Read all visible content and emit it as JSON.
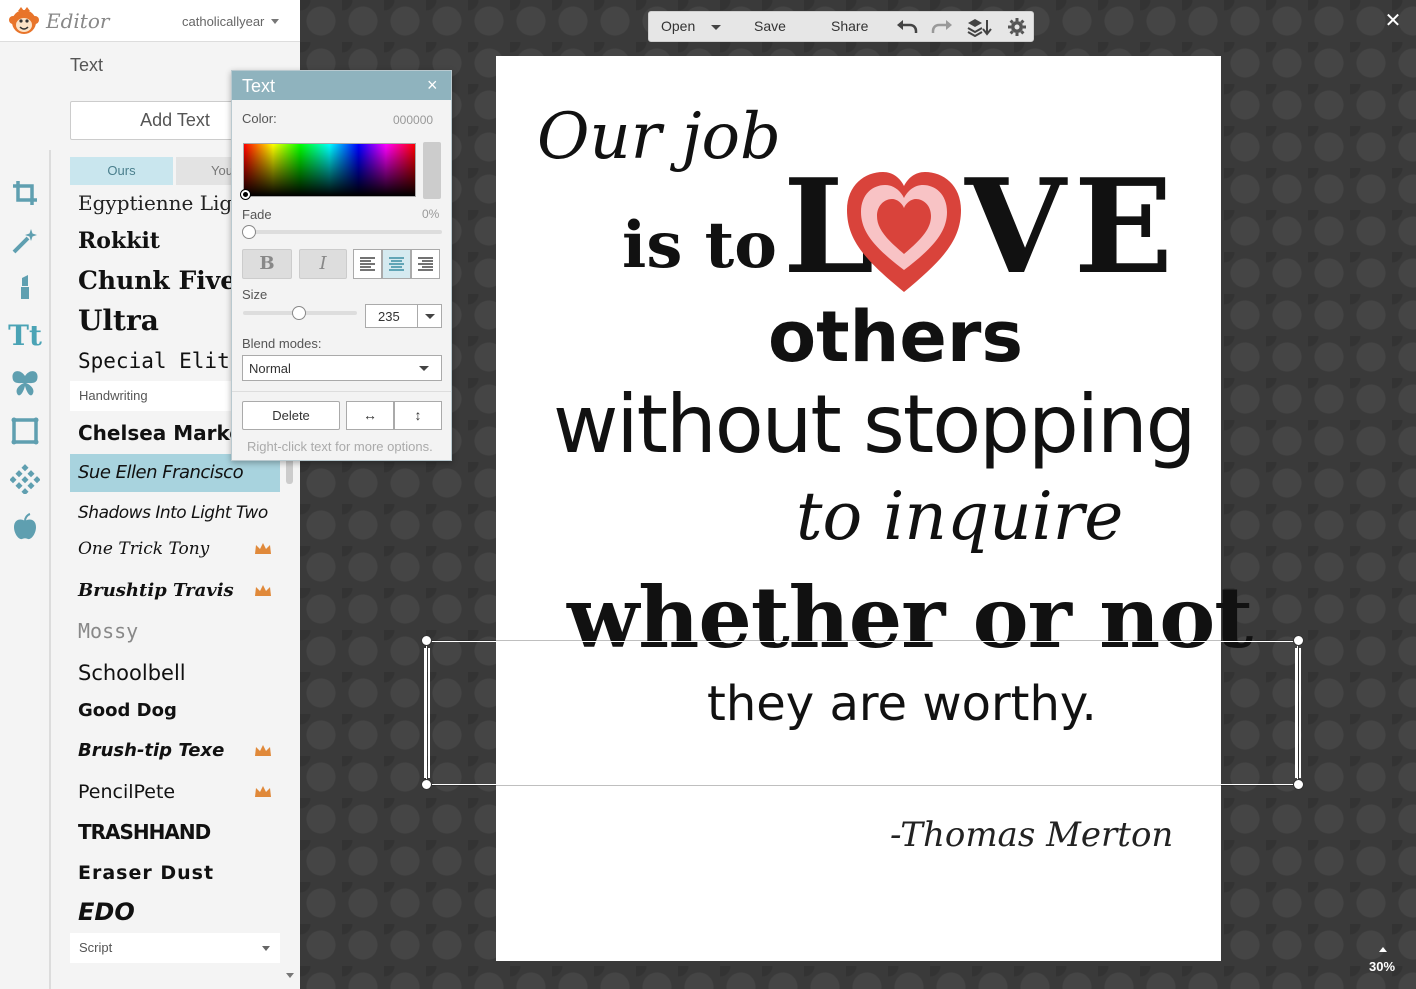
{
  "app": {
    "title": "Editor",
    "account": "catholicallyear"
  },
  "panel": {
    "title": "Text",
    "add_text": "Add Text",
    "tabs": [
      "Ours",
      "You"
    ]
  },
  "fonts": {
    "egyptienne": "Egyptienne Light",
    "rokkit": "Rokkit",
    "chunk_five": "Chunk Five",
    "ultra": "Ultra",
    "special_elite": "Special Elite",
    "handwriting_header": "Handwriting",
    "chelsea": "Chelsea Market",
    "sue_ellen": "Sue Ellen Francisco",
    "shadows": "Shadows Into Light Two",
    "one_trick": "One Trick Tony",
    "brushtip_travis": "Brushtip Travis",
    "mossy": "Mossy",
    "schoolbell": "Schoolbell",
    "good_dog": "Good Dog",
    "brush_tip_texe": "Brush-tip Texe",
    "pencilpete": "PencilPete",
    "trashhand": "TRASHHAND",
    "eraser_dust": "Eraser Dust",
    "edo": "EDO",
    "script_header": "Script"
  },
  "toolbar": {
    "open": "Open",
    "save": "Save",
    "share": "Share"
  },
  "dialog": {
    "title": "Text",
    "close": "×",
    "color_label": "Color:",
    "color_value": "000000",
    "fade_label": "Fade",
    "fade_value": "0%",
    "fade_level": 0,
    "bold": "B",
    "italic": "I",
    "alignment": "center",
    "size_label": "Size",
    "size_value": "235",
    "blend_label": "Blend modes:",
    "blend_value": "Normal",
    "delete": "Delete",
    "flip_h": "↔",
    "flip_v": "↕",
    "hint": "Right-click text for more options."
  },
  "canvas": {
    "line1": "Our job",
    "line2": "is to",
    "love_l": "L",
    "love_ve": "VE",
    "line3": "others",
    "line4": "without  stopping",
    "line5": "to inquire",
    "line6": "whether or not",
    "line7": "they are worthy.",
    "author": "-Thomas Merton",
    "heart_colors": {
      "outer": "#d9433b",
      "middle": "#f8c3c5",
      "inner": "#d9433b"
    }
  },
  "zoom": {
    "value": "30%"
  },
  "colors": {
    "accent": "#4aa3b5",
    "dialog_header": "#8fb3be",
    "crown": "#e0893a",
    "selected_font": "#a8d3de"
  }
}
